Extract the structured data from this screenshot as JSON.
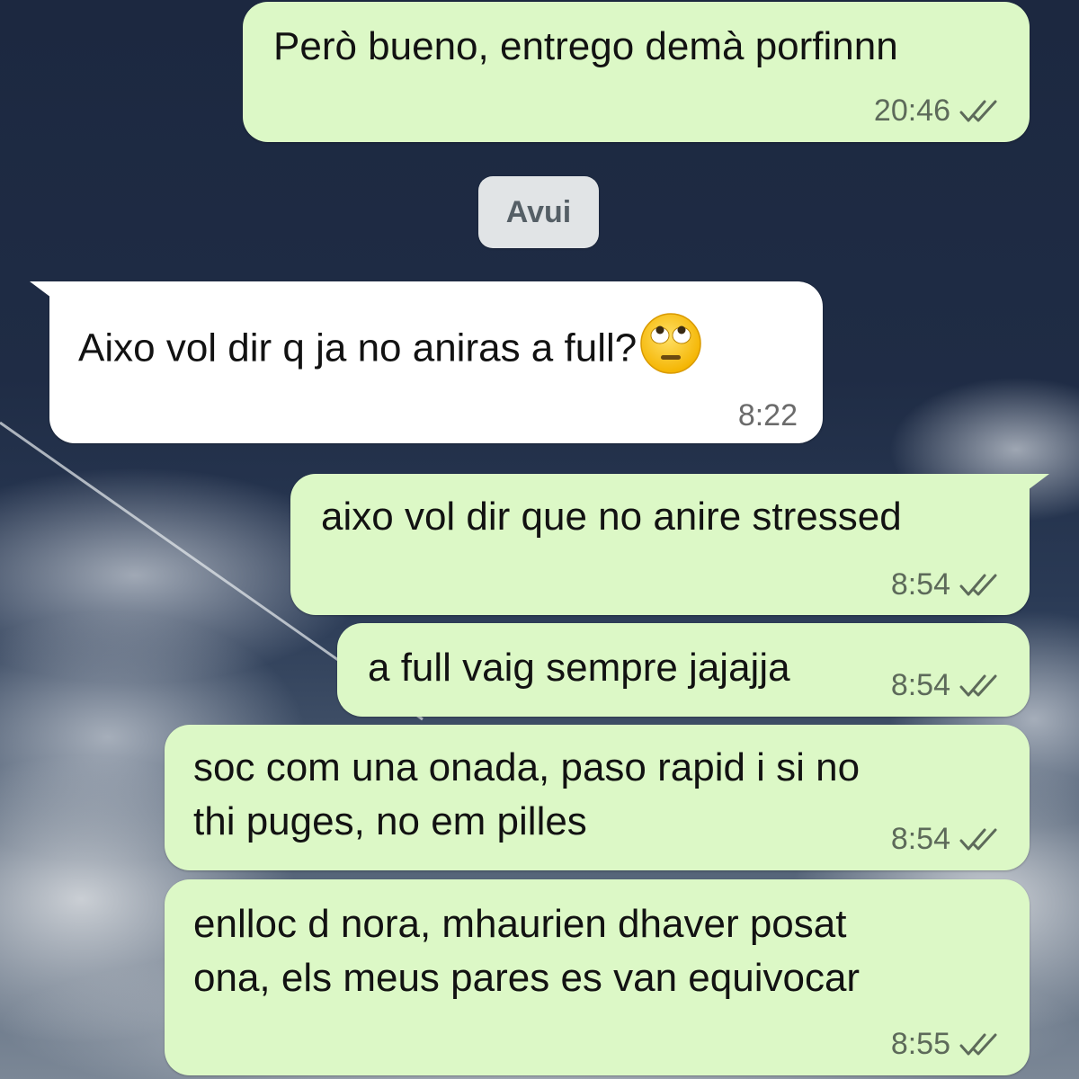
{
  "chat": {
    "date_separator": "Avui",
    "messages": [
      {
        "text": "Però bueno, entrego demà porfinnn",
        "time": "20:46",
        "direction": "outgoing",
        "status_icon": "double-check-icon"
      },
      {
        "text": "Aixo vol dir q ja no aniras a full?",
        "emoji": "face-with-rolling-eyes-icon",
        "time": "8:22",
        "direction": "incoming"
      },
      {
        "text": "aixo vol dir que no anire stressed",
        "time": "8:54",
        "direction": "outgoing",
        "status_icon": "double-check-icon"
      },
      {
        "text": "a full vaig sempre jajajja",
        "time": "8:54",
        "direction": "outgoing",
        "status_icon": "double-check-icon"
      },
      {
        "line1": "soc com una onada, paso rapid i si no",
        "line2": "thi puges, no em pilles",
        "time": "8:54",
        "direction": "outgoing",
        "status_icon": "double-check-icon"
      },
      {
        "line1": "enlloc d nora, mhaurien dhaver posat",
        "line2": "ona, els meus pares es van equivocar",
        "time": "8:55",
        "direction": "outgoing",
        "status_icon": "double-check-icon"
      }
    ]
  },
  "colors": {
    "outgoing_bubble": "#dcf8c6",
    "incoming_bubble": "#ffffff",
    "date_chip": "#e1e4e6"
  }
}
